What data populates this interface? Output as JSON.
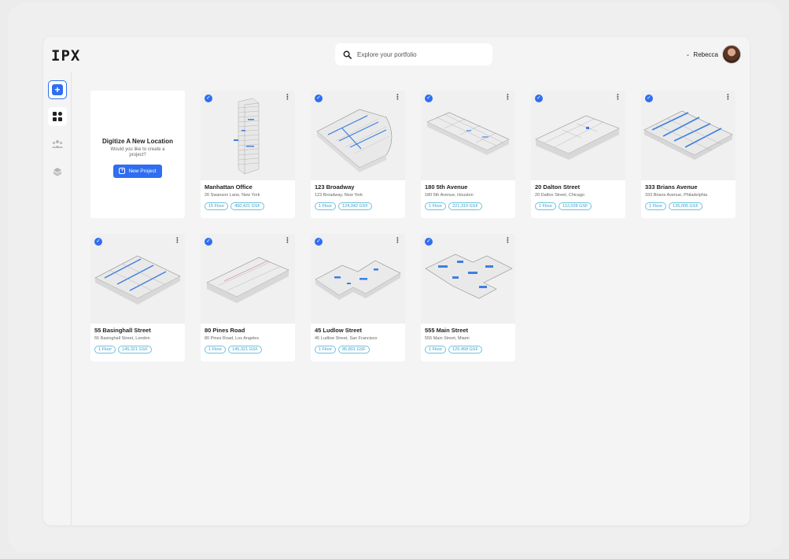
{
  "app": {
    "logo": "IPX"
  },
  "search": {
    "placeholder": "Explore your portfolio",
    "icon": "search-icon"
  },
  "user": {
    "name": "Rebecca",
    "chevron": "⌄"
  },
  "sidebar": {
    "items": [
      {
        "name": "add",
        "icon": "plus-icon"
      },
      {
        "name": "portfolio",
        "icon": "grid-icon"
      },
      {
        "name": "team",
        "icon": "users-icon"
      },
      {
        "name": "layers",
        "icon": "layers-icon"
      }
    ]
  },
  "new_project_card": {
    "title": "Digitize A New Location",
    "subtitle": "Would you like to create a project?",
    "button_label": "New Project"
  },
  "projects": [
    {
      "title": "Manhattan Office",
      "address": "26 Swanson Lane, New York",
      "floors": "15 Floor",
      "gsf": "450,421 GSF"
    },
    {
      "title": "123 Broadway",
      "address": "123 Broadway, New York",
      "floors": "1 Floor",
      "gsf": "124,042 GSF"
    },
    {
      "title": "180 5th Avenue",
      "address": "180 5th Avenue, Houston",
      "floors": "1 Floor",
      "gsf": "221,310 GSF"
    },
    {
      "title": "20 Dalton Street",
      "address": "20 Dalton Street, Chicago",
      "floors": "1 Floor",
      "gsf": "112,028 GSF"
    },
    {
      "title": "333 Brians Avenue",
      "address": "333 Brians Avenue, Philadelphia",
      "floors": "1 Floor",
      "gsf": "135,005 GSF"
    },
    {
      "title": "55 Basinghall Street",
      "address": "55 Basinghall Street, London",
      "floors": "1 Floor",
      "gsf": "145,321 GSF"
    },
    {
      "title": "80 Pines Road",
      "address": "80 Pines Road, Los Angeles",
      "floors": "1 Floor",
      "gsf": "145,321 GSF"
    },
    {
      "title": "45 Ludlow Street",
      "address": "45 Ludlow Street, San Francisco",
      "floors": "1 Floor",
      "gsf": "85,801 GSF"
    },
    {
      "title": "555 Main Street",
      "address": "555 Main Street, Miami",
      "floors": "1 Floor",
      "gsf": "125,458 GSF"
    }
  ],
  "colors": {
    "accent": "#2f6ef0",
    "tag_border": "#6cc2e0"
  }
}
